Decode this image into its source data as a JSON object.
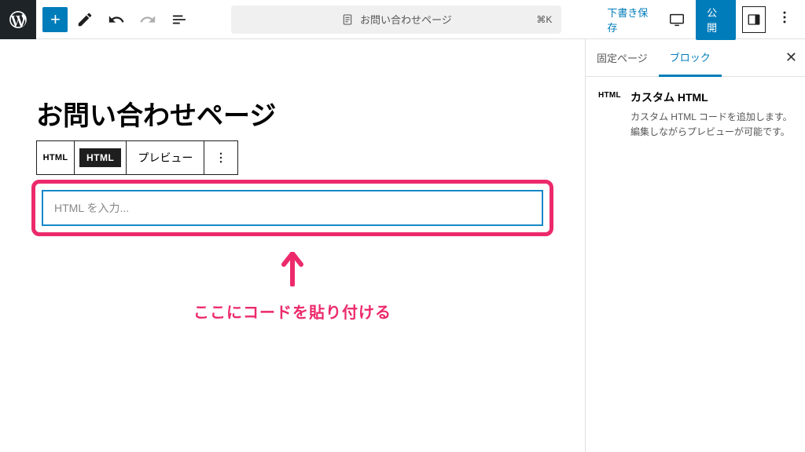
{
  "header": {
    "document_title": "お問い合わせページ",
    "shortcut": "⌘K",
    "draft_label": "下書き保存",
    "publish_label": "公開"
  },
  "editor": {
    "page_title": "お問い合わせページ",
    "block_toolbar": {
      "type_chip_small": "HTML",
      "html_chip": "HTML",
      "preview_label": "プレビュー"
    },
    "html_input_placeholder": "HTML を入力...",
    "annotation_text": "ここにコードを貼り付ける"
  },
  "sidebar": {
    "tabs": {
      "page": "固定ページ",
      "block": "ブロック"
    },
    "block_panel": {
      "icon_label": "HTML",
      "title": "カスタム HTML",
      "description": "カスタム HTML コードを追加します。編集しながらプレビューが可能です。"
    }
  }
}
